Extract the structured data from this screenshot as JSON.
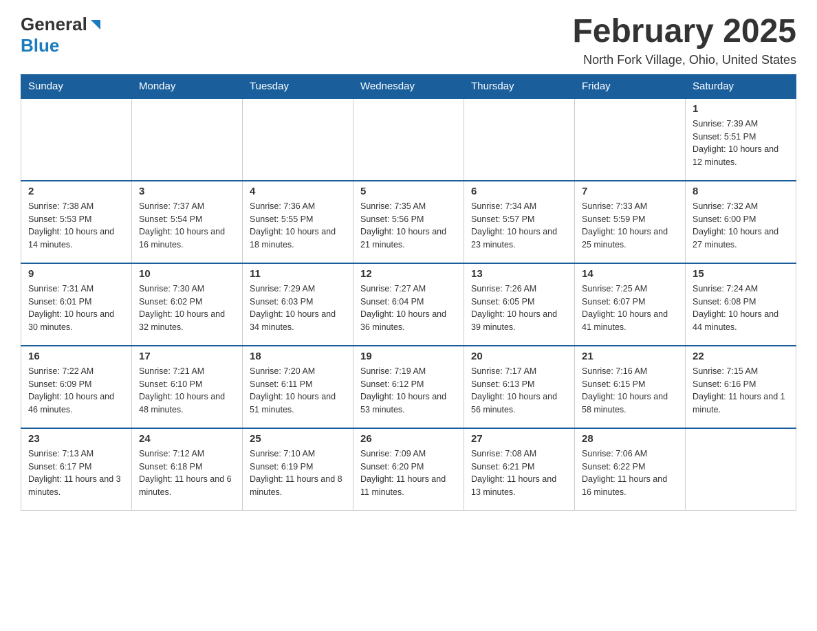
{
  "header": {
    "logo_general": "General",
    "logo_blue": "Blue",
    "month_title": "February 2025",
    "location": "North Fork Village, Ohio, United States"
  },
  "days_of_week": [
    "Sunday",
    "Monday",
    "Tuesday",
    "Wednesday",
    "Thursday",
    "Friday",
    "Saturday"
  ],
  "weeks": [
    [
      {
        "day": "",
        "info": ""
      },
      {
        "day": "",
        "info": ""
      },
      {
        "day": "",
        "info": ""
      },
      {
        "day": "",
        "info": ""
      },
      {
        "day": "",
        "info": ""
      },
      {
        "day": "",
        "info": ""
      },
      {
        "day": "1",
        "info": "Sunrise: 7:39 AM\nSunset: 5:51 PM\nDaylight: 10 hours and 12 minutes."
      }
    ],
    [
      {
        "day": "2",
        "info": "Sunrise: 7:38 AM\nSunset: 5:53 PM\nDaylight: 10 hours and 14 minutes."
      },
      {
        "day": "3",
        "info": "Sunrise: 7:37 AM\nSunset: 5:54 PM\nDaylight: 10 hours and 16 minutes."
      },
      {
        "day": "4",
        "info": "Sunrise: 7:36 AM\nSunset: 5:55 PM\nDaylight: 10 hours and 18 minutes."
      },
      {
        "day": "5",
        "info": "Sunrise: 7:35 AM\nSunset: 5:56 PM\nDaylight: 10 hours and 21 minutes."
      },
      {
        "day": "6",
        "info": "Sunrise: 7:34 AM\nSunset: 5:57 PM\nDaylight: 10 hours and 23 minutes."
      },
      {
        "day": "7",
        "info": "Sunrise: 7:33 AM\nSunset: 5:59 PM\nDaylight: 10 hours and 25 minutes."
      },
      {
        "day": "8",
        "info": "Sunrise: 7:32 AM\nSunset: 6:00 PM\nDaylight: 10 hours and 27 minutes."
      }
    ],
    [
      {
        "day": "9",
        "info": "Sunrise: 7:31 AM\nSunset: 6:01 PM\nDaylight: 10 hours and 30 minutes."
      },
      {
        "day": "10",
        "info": "Sunrise: 7:30 AM\nSunset: 6:02 PM\nDaylight: 10 hours and 32 minutes."
      },
      {
        "day": "11",
        "info": "Sunrise: 7:29 AM\nSunset: 6:03 PM\nDaylight: 10 hours and 34 minutes."
      },
      {
        "day": "12",
        "info": "Sunrise: 7:27 AM\nSunset: 6:04 PM\nDaylight: 10 hours and 36 minutes."
      },
      {
        "day": "13",
        "info": "Sunrise: 7:26 AM\nSunset: 6:05 PM\nDaylight: 10 hours and 39 minutes."
      },
      {
        "day": "14",
        "info": "Sunrise: 7:25 AM\nSunset: 6:07 PM\nDaylight: 10 hours and 41 minutes."
      },
      {
        "day": "15",
        "info": "Sunrise: 7:24 AM\nSunset: 6:08 PM\nDaylight: 10 hours and 44 minutes."
      }
    ],
    [
      {
        "day": "16",
        "info": "Sunrise: 7:22 AM\nSunset: 6:09 PM\nDaylight: 10 hours and 46 minutes."
      },
      {
        "day": "17",
        "info": "Sunrise: 7:21 AM\nSunset: 6:10 PM\nDaylight: 10 hours and 48 minutes."
      },
      {
        "day": "18",
        "info": "Sunrise: 7:20 AM\nSunset: 6:11 PM\nDaylight: 10 hours and 51 minutes."
      },
      {
        "day": "19",
        "info": "Sunrise: 7:19 AM\nSunset: 6:12 PM\nDaylight: 10 hours and 53 minutes."
      },
      {
        "day": "20",
        "info": "Sunrise: 7:17 AM\nSunset: 6:13 PM\nDaylight: 10 hours and 56 minutes."
      },
      {
        "day": "21",
        "info": "Sunrise: 7:16 AM\nSunset: 6:15 PM\nDaylight: 10 hours and 58 minutes."
      },
      {
        "day": "22",
        "info": "Sunrise: 7:15 AM\nSunset: 6:16 PM\nDaylight: 11 hours and 1 minute."
      }
    ],
    [
      {
        "day": "23",
        "info": "Sunrise: 7:13 AM\nSunset: 6:17 PM\nDaylight: 11 hours and 3 minutes."
      },
      {
        "day": "24",
        "info": "Sunrise: 7:12 AM\nSunset: 6:18 PM\nDaylight: 11 hours and 6 minutes."
      },
      {
        "day": "25",
        "info": "Sunrise: 7:10 AM\nSunset: 6:19 PM\nDaylight: 11 hours and 8 minutes."
      },
      {
        "day": "26",
        "info": "Sunrise: 7:09 AM\nSunset: 6:20 PM\nDaylight: 11 hours and 11 minutes."
      },
      {
        "day": "27",
        "info": "Sunrise: 7:08 AM\nSunset: 6:21 PM\nDaylight: 11 hours and 13 minutes."
      },
      {
        "day": "28",
        "info": "Sunrise: 7:06 AM\nSunset: 6:22 PM\nDaylight: 11 hours and 16 minutes."
      },
      {
        "day": "",
        "info": ""
      }
    ]
  ]
}
